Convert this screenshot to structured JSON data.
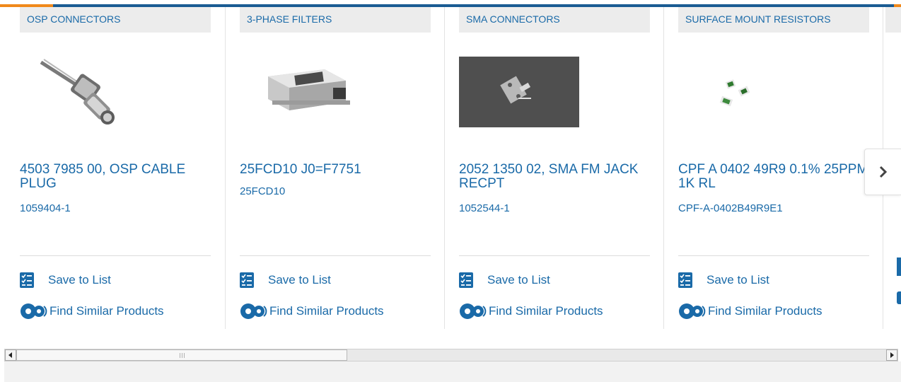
{
  "products": [
    {
      "category": "OSP CONNECTORS",
      "title": "4503 7985 00, OSP CABLE PLUG",
      "part_number": "1059404-1",
      "image": "osp-cable-plug-image",
      "save_label": "Save to List",
      "similar_label": "Find Similar Products"
    },
    {
      "category": "3-PHASE FILTERS",
      "title": "25FCD10 J0=F7751",
      "part_number": "25FCD10",
      "image": "three-phase-filter-image",
      "save_label": "Save to List",
      "similar_label": "Find Similar Products"
    },
    {
      "category": "SMA CONNECTORS",
      "title": "2052 1350 02, SMA FM JACK RECPT",
      "part_number": "1052544-1",
      "image": "sma-jack-receptacle-image",
      "save_label": "Save to List",
      "similar_label": "Find Similar Products"
    },
    {
      "category": "SURFACE MOUNT RESISTORS",
      "title": "CPF A 0402 49R9 0.1% 25PPM 1K RL",
      "part_number": "CPF-A-0402B49R9E1",
      "image": "smd-resistor-image",
      "save_label": "Save to List",
      "similar_label": "Find Similar Products"
    }
  ],
  "carousel": {
    "next_icon": "chevron-right-icon"
  },
  "icons": {
    "save": "checklist-icon",
    "similar": "gears-icon"
  },
  "colors": {
    "link": "#1a6aa8",
    "accent_orange": "#f0891b",
    "brand_blue": "#1a5c93",
    "category_bg": "#ececec"
  }
}
